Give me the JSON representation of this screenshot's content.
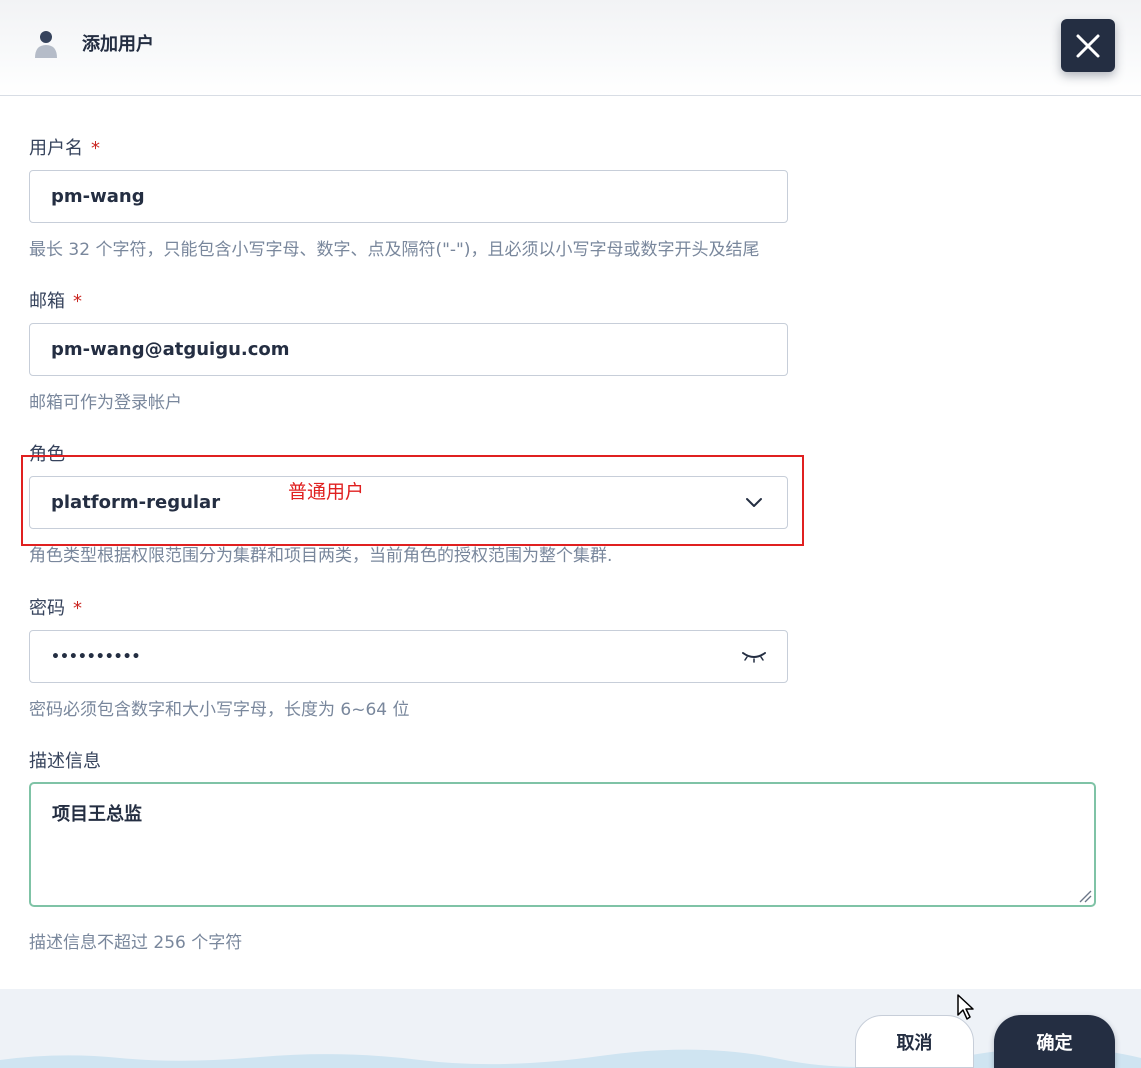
{
  "header": {
    "title": "添加用户",
    "icon": "user-icon",
    "close_icon": "close-icon"
  },
  "form": {
    "username": {
      "label": "用户名",
      "required_mark": "*",
      "value": "pm-wang",
      "hint": "最长 32 个字符，只能包含小写字母、数字、点及隔符(\"-\")，且必须以小写字母或数字开头及结尾"
    },
    "email": {
      "label": "邮箱",
      "required_mark": "*",
      "value": "pm-wang@atguigu.com",
      "hint": "邮箱可作为登录帐户"
    },
    "role": {
      "label": "角色",
      "value": "platform-regular",
      "hint": "角色类型根据权限范围分为集群和项目两类，当前角色的授权范围为整个集群.",
      "chevron_icon": "chevron-down-icon"
    },
    "password": {
      "label": "密码",
      "required_mark": "*",
      "value": "••••••••••",
      "hint": "密码必须包含数字和大小写字母，长度为 6~64 位",
      "eye_icon": "eye-closed-icon"
    },
    "description": {
      "label": "描述信息",
      "value": "项目王总监",
      "hint": "描述信息不超过 256 个字符"
    }
  },
  "annotation": {
    "text": "普通用户",
    "color": "#e02020"
  },
  "footer": {
    "cancel_label": "取消",
    "ok_label": "确定"
  },
  "colors": {
    "primary_dark": "#242e42",
    "required": "#ca2621",
    "focus_border": "#7fc3a6"
  }
}
